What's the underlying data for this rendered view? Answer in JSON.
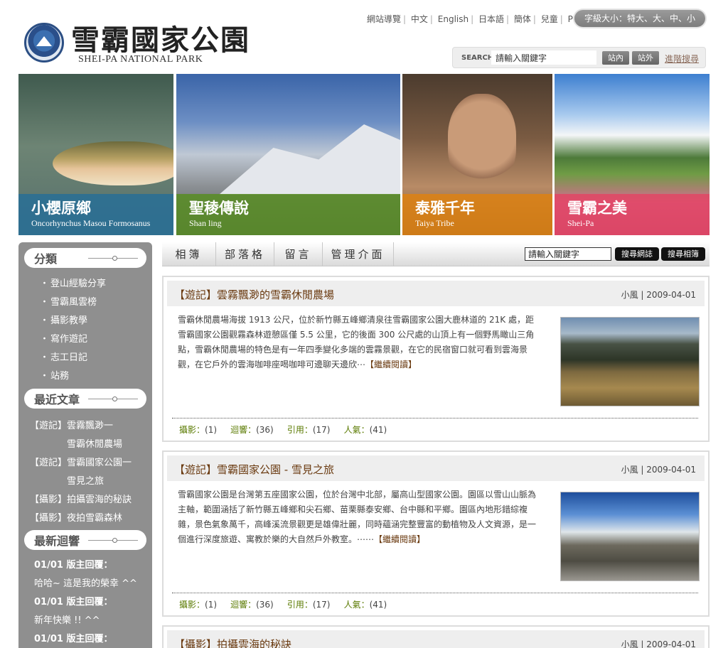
{
  "header": {
    "title_zh": "雪霸國家公園",
    "title_en": "SHEI-PA NATIONAL PARK",
    "toplinks": [
      "網站導覽",
      "中文",
      "English",
      "日本語",
      "簡体",
      "兒童",
      "PDA"
    ],
    "fontsize_label": "字級大小：特大、大、中、小",
    "search": {
      "label": "SEARCH",
      "placeholder": "請輸入關鍵字",
      "btn_inside": "站內",
      "btn_outside": "站外",
      "advanced": "進階搜尋"
    }
  },
  "banner": [
    {
      "title": "小櫻原鄉",
      "subtitle": "Oncorhynchus Masou Formosanus"
    },
    {
      "title": "聖稜傳說",
      "subtitle": "Shan ling"
    },
    {
      "title": "泰雅千年",
      "subtitle": "Taiya Tribe"
    },
    {
      "title": "雪霸之美",
      "subtitle": "Shei-Pa"
    }
  ],
  "sidebar": {
    "categories_heading": "分類",
    "categories": [
      "登山經驗分享",
      "雪霸風雲榜",
      "攝影教學",
      "寫作遊記",
      "志工日記",
      "站務"
    ],
    "recent_heading": "最近文章",
    "recent": [
      {
        "tag": "【遊記】",
        "line1": "雲霧飄渺一",
        "line2": "雪霸休閒農場"
      },
      {
        "tag": "【遊記】",
        "line1": "雪霸國家公園一",
        "line2": "雪見之旅"
      },
      {
        "tag": "【攝影】",
        "line1": "拍攝雲海的秘訣",
        "line2": ""
      },
      {
        "tag": "【攝影】",
        "line1": "夜拍雪霸森林",
        "line2": ""
      }
    ],
    "responses_heading": "最新迴響",
    "responses": [
      {
        "head": "01/01 版主回覆：",
        "body": "哈哈~ 這是我的榮幸 ^^"
      },
      {
        "head": "01/01 版主回覆：",
        "body": "新年快樂 !! ^^"
      },
      {
        "head": "01/01 版主回覆：",
        "body": ""
      }
    ]
  },
  "mainnav": {
    "tabs": [
      "相簿",
      "部落格",
      "留言",
      "管理介面"
    ],
    "search_value": "請輸入關鍵字",
    "btn_blog": "搜尋網誌",
    "btn_album": "搜尋相簿"
  },
  "posts": [
    {
      "title": "【遊記】雲霧飄渺的雪霸休閒農場",
      "meta": "小風 | 2009-04-01",
      "body": "雪霸休閒農場海拔 1913 公尺，位於新竹縣五峰鄉清泉往雪霸國家公園大鹿林道的 21K 處，距雪霸國家公園觀霧森林遊憩區僅 5.5 公里，它的後面 300 公尺處的山頂上有一個野馬瞰山三角點，雪霸休閒農場的特色是有一年四季變化多端的雲霧景觀，在它的民宿窗口就可看到雲海景觀，在它戶外的雲海咖啡座喝咖啡可邊聊天邊欣⋯",
      "more": "【繼續閱讀】",
      "stats": {
        "photo_k": "攝影：",
        "photo_v": "(1)",
        "resp_k": "迴響：",
        "resp_v": "(36)",
        "ref_k": "引用：",
        "ref_v": "(17)",
        "pop_k": "人氣：",
        "pop_v": "(41)"
      }
    },
    {
      "title": "【遊記】雪霸國家公園 - 雪見之旅",
      "meta": "小風 | 2009-04-01",
      "body": "雪霸國家公園是台灣第五座國家公園，位於台灣中北部，屬高山型國家公園。園區以雪山山脈為主軸，範圍涵括了新竹縣五峰鄉和尖石鄉、苗栗縣泰安鄉、台中縣和平鄉。園區內地形錯綜複雜，景色氣象萬千，高峰溪流景觀更是雄偉壯麗，同時蘊涵完整豐富的動植物及人文資源，是一個進行深度旅遊、寓教於樂的大自然戶外教室。⋯⋯",
      "more": "【繼續閱讀】",
      "stats": {
        "photo_k": "攝影：",
        "photo_v": "(1)",
        "resp_k": "迴響：",
        "resp_v": "(36)",
        "ref_k": "引用：",
        "ref_v": "(17)",
        "pop_k": "人氣：",
        "pop_v": "(41)"
      }
    },
    {
      "title": "【攝影】拍攝雲海的秘訣",
      "meta": "小風 | 2009-04-01"
    }
  ]
}
